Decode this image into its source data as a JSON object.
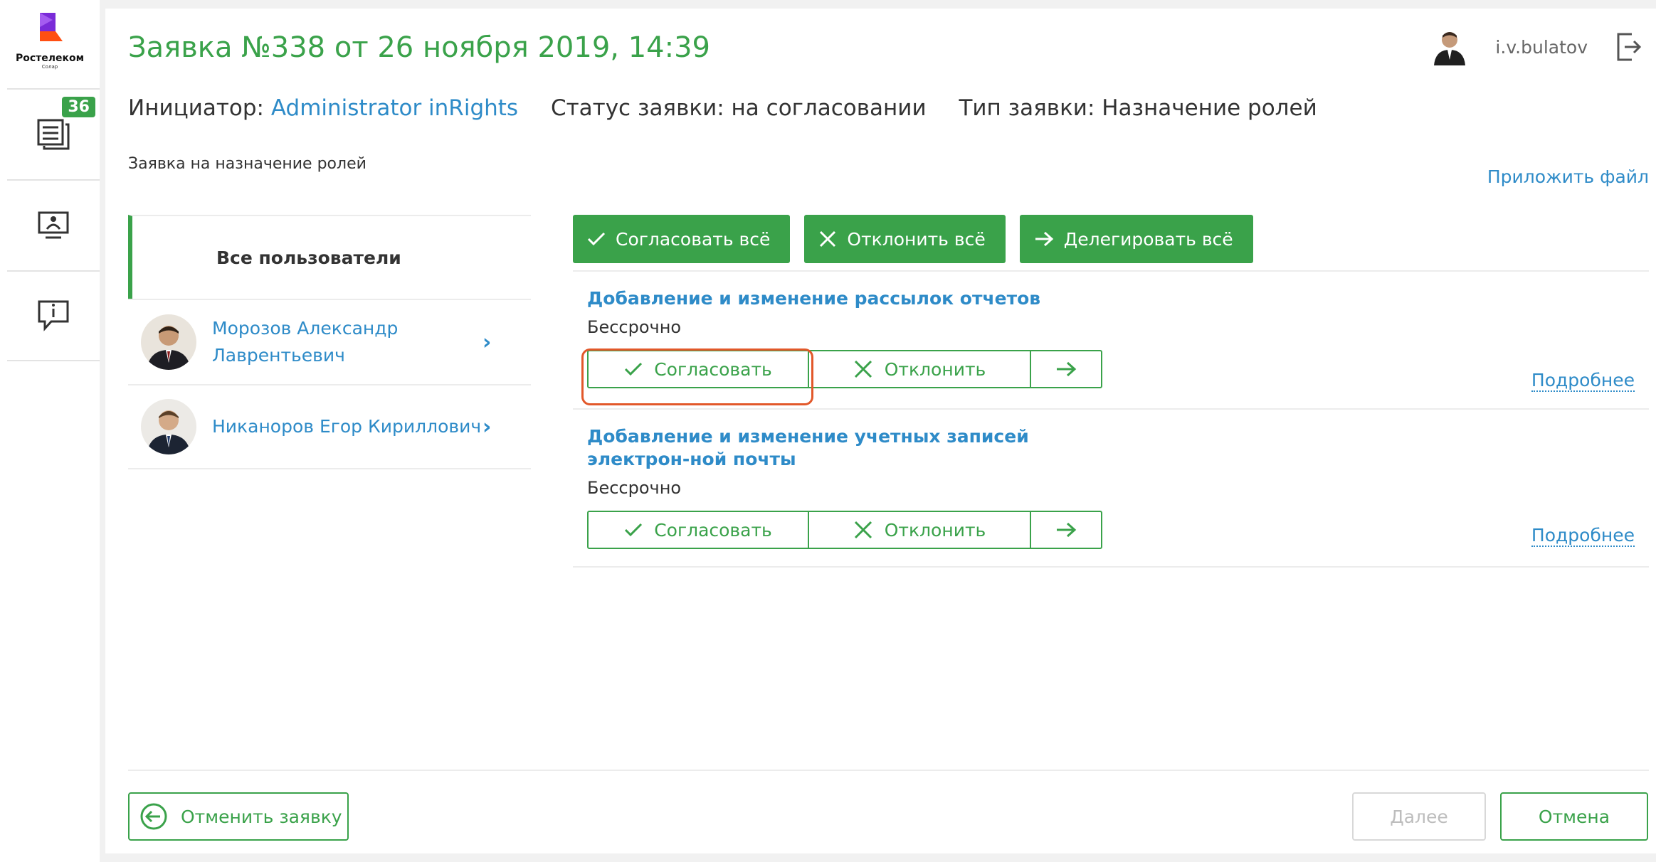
{
  "app": {
    "brand": "Ростелеком",
    "brand_sub": "Солар",
    "notifications_count": "36"
  },
  "header": {
    "title": "Заявка №338 от 26 ноября 2019, 14:39",
    "initiator_label": "Инициатор:",
    "initiator_value": "Administrator inRights",
    "status_label": "Статус заявки:",
    "status_value": "на согласовании",
    "type_label": "Тип заявки:",
    "type_value": "Назначение ролей",
    "subtitle": "Заявка на назначение ролей",
    "attach_label": "Приложить файл",
    "username": "i.v.bulatov"
  },
  "users": {
    "all_label": "Все пользователи",
    "items": [
      {
        "name": "Морозов Александр Лаврентьевич"
      },
      {
        "name": "Никаноров Егор Кириллович"
      }
    ]
  },
  "bulk": {
    "approve_all": "Согласовать всё",
    "reject_all": "Отклонить всё",
    "delegate_all": "Делегировать всё"
  },
  "roles": [
    {
      "title": "Добавление и изменение рассылок отчетов",
      "term": "Бессрочно",
      "approve": "Согласовать",
      "reject": "Отклонить",
      "more": "Подробнее"
    },
    {
      "title": "Добавление и изменение учетных записей электрон-ной почты",
      "term": "Бессрочно",
      "approve": "Согласовать",
      "reject": "Отклонить",
      "more": "Подробнее"
    }
  ],
  "footer": {
    "cancel_request": "Отменить заявку",
    "next": "Далее",
    "cancel": "Отмена"
  },
  "colors": {
    "accent": "#3aa24a",
    "link": "#2e8bc8",
    "highlight": "#e2582a"
  }
}
